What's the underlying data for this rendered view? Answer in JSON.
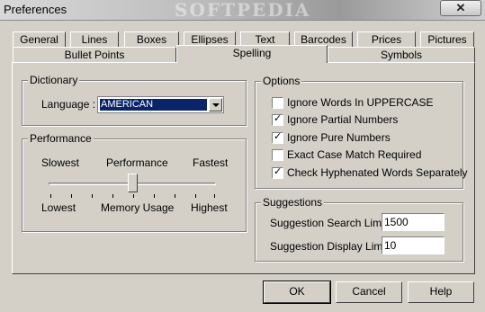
{
  "window": {
    "title": "Preferences",
    "watermark": "SOFTPEDIA",
    "close_glyph": "✕"
  },
  "tabs_row1": [
    "General",
    "Lines",
    "Boxes",
    "Ellipses",
    "Text",
    "Barcodes",
    "Prices",
    "Pictures"
  ],
  "tabs_row2": [
    "Bullet Points",
    "Spelling",
    "Symbols"
  ],
  "active_tab": "Spelling",
  "dictionary": {
    "title": "Dictionary",
    "language_label": "Language :",
    "language_value": "AMERICAN"
  },
  "performance": {
    "title": "Performance",
    "top_labels": {
      "left": "Slowest",
      "mid": "Performance",
      "right": "Fastest"
    },
    "bottom_labels": {
      "left": "Lowest",
      "mid": "Memory Usage",
      "right": "Highest"
    },
    "level": 0.5
  },
  "options": {
    "title": "Options",
    "items": [
      {
        "label": "Ignore Words In UPPERCASE",
        "checked": false
      },
      {
        "label": "Ignore Partial Numbers",
        "checked": true
      },
      {
        "label": "Ignore Pure Numbers",
        "checked": true
      },
      {
        "label": "Exact Case Match Required",
        "checked": false
      },
      {
        "label": "Check Hyphenated Words Separately",
        "checked": true
      }
    ]
  },
  "suggestions": {
    "title": "Suggestions",
    "search_limit_label": "Suggestion Search Limit :",
    "search_limit_value": "1500",
    "display_limit_label": "Suggestion Display Limit :",
    "display_limit_value": "10"
  },
  "buttons": {
    "ok": "OK",
    "cancel": "Cancel",
    "help": "Help"
  }
}
